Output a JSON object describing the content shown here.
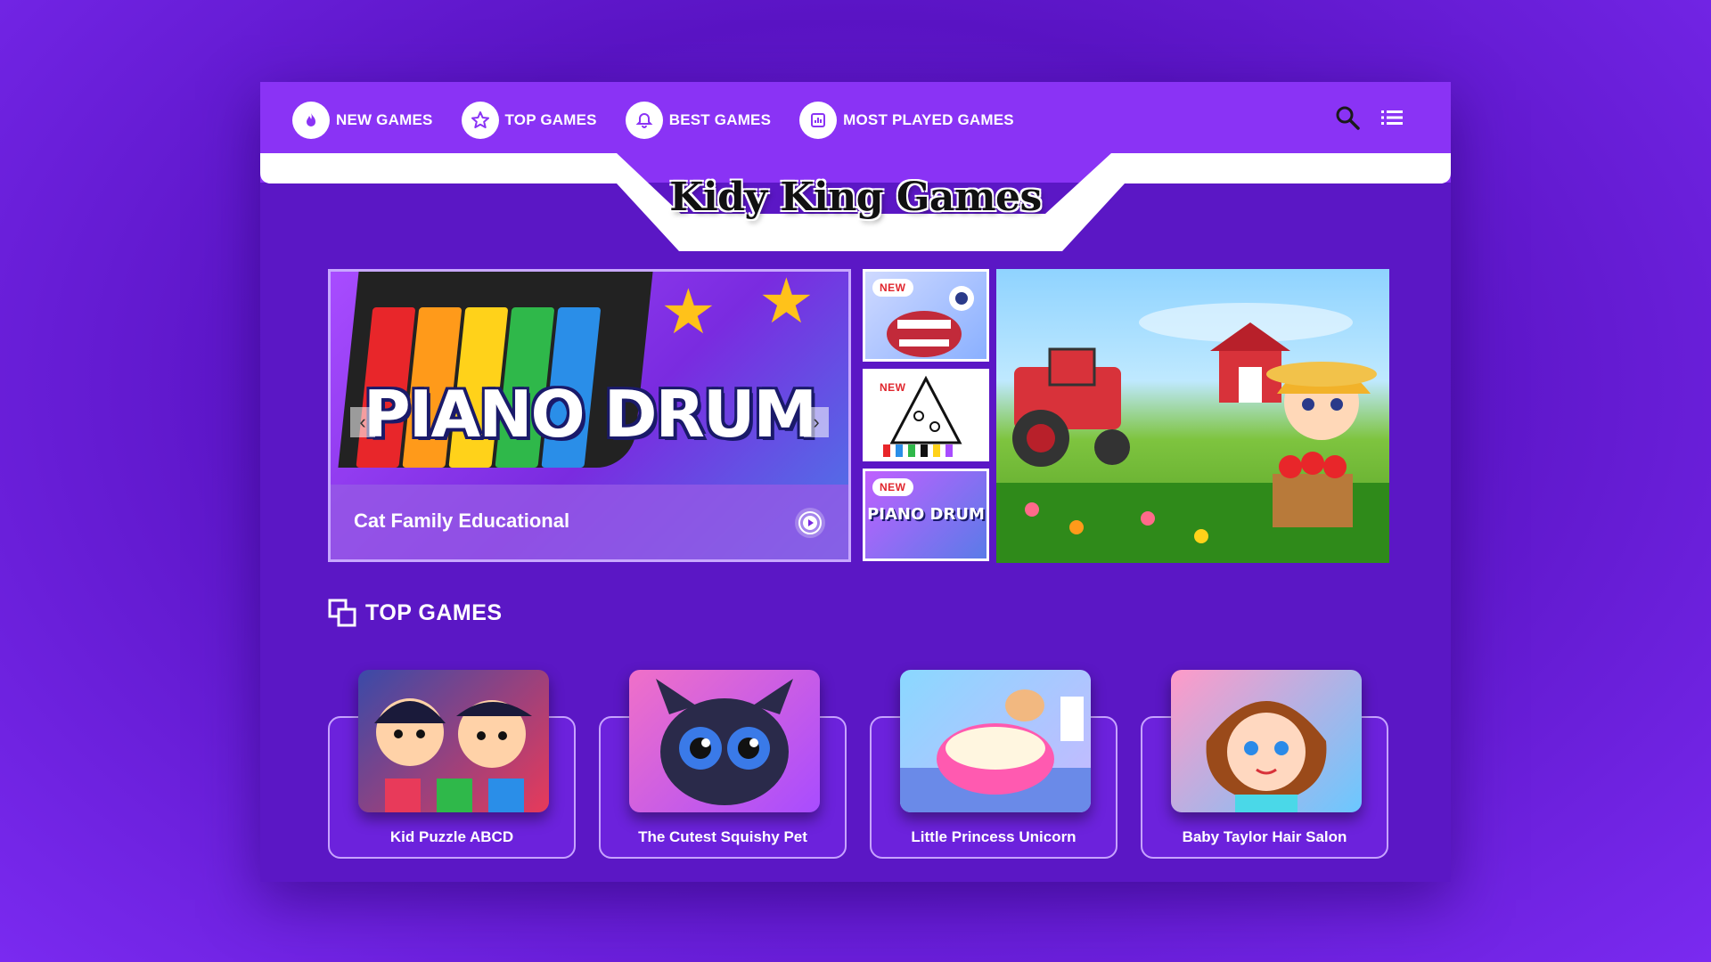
{
  "nav": {
    "items": [
      {
        "label": "NEW GAMES",
        "icon": "flame-icon"
      },
      {
        "label": "TOP GAMES",
        "icon": "star-icon"
      },
      {
        "label": "BEST GAMES",
        "icon": "bell-icon"
      },
      {
        "label": "MOST PLAYED GAMES",
        "icon": "chart-icon"
      }
    ],
    "search_icon": "search-icon",
    "menu_icon": "list-menu-icon"
  },
  "logo": "Kidy King Games",
  "hero": {
    "title_art": "PIANO DRUM",
    "caption": "Cat Family Educational",
    "thumbnails": [
      {
        "badge": "NEW"
      },
      {
        "badge": "NEW"
      },
      {
        "badge": "NEW",
        "art_text": "PIANO DRUM"
      }
    ]
  },
  "top_games": {
    "title": "TOP GAMES",
    "cards": [
      {
        "label": "Kid Puzzle ABCD"
      },
      {
        "label": "The Cutest Squishy Pet"
      },
      {
        "label": "Little Princess Unicorn"
      },
      {
        "label": "Baby Taylor Hair Salon"
      }
    ]
  },
  "colors": {
    "background": "#5a14c4",
    "topbar": "#8a33f5",
    "accent_border": "#c7a3ff",
    "badge_text": "#e0262d"
  }
}
